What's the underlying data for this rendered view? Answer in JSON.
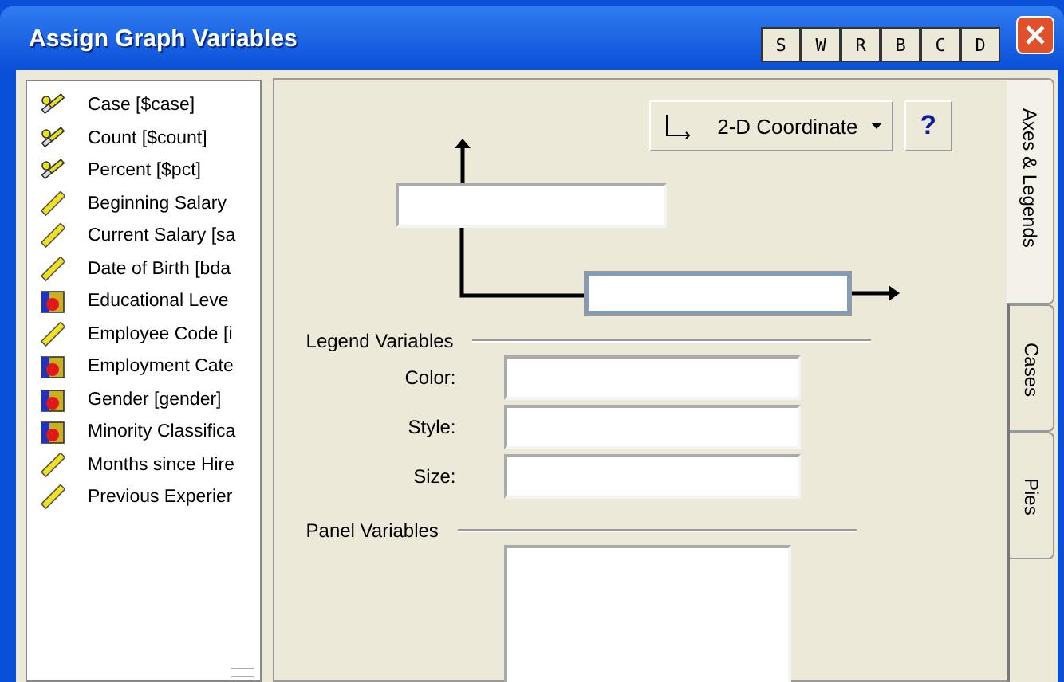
{
  "window": {
    "title": "Assign Graph Variables",
    "title_buttons": [
      "S",
      "W",
      "R",
      "B",
      "C",
      "D"
    ]
  },
  "variables": [
    {
      "label": "Case [$case]",
      "kind": "system"
    },
    {
      "label": "Count [$count]",
      "kind": "system"
    },
    {
      "label": "Percent [$pct]",
      "kind": "system"
    },
    {
      "label": "Beginning Salary",
      "kind": "scale"
    },
    {
      "label": "Current Salary [sa",
      "kind": "scale"
    },
    {
      "label": "Date of Birth [bda",
      "kind": "scale"
    },
    {
      "label": "Educational Leve",
      "kind": "nominal"
    },
    {
      "label": "Employee Code [i",
      "kind": "scale"
    },
    {
      "label": "Employment Cate",
      "kind": "nominal"
    },
    {
      "label": "Gender [gender]",
      "kind": "nominal"
    },
    {
      "label": "Minority Classifica",
      "kind": "nominal"
    },
    {
      "label": "Months since Hire",
      "kind": "scale"
    },
    {
      "label": "Previous Experier",
      "kind": "scale"
    }
  ],
  "chart_type": {
    "label": "2-D Coordinate",
    "help": "?"
  },
  "axes": {
    "y_field": {
      "focused": false
    },
    "x_field": {
      "focused": true
    }
  },
  "legend": {
    "heading": "Legend Variables",
    "rows": [
      {
        "label": "Color:"
      },
      {
        "label": "Style:"
      },
      {
        "label": "Size:"
      }
    ]
  },
  "panel": {
    "heading": "Panel Variables"
  },
  "tabs": [
    {
      "label": "Axes & Legends",
      "selected": true
    },
    {
      "label": "Cases",
      "selected": false
    },
    {
      "label": "Pies",
      "selected": false
    }
  ]
}
